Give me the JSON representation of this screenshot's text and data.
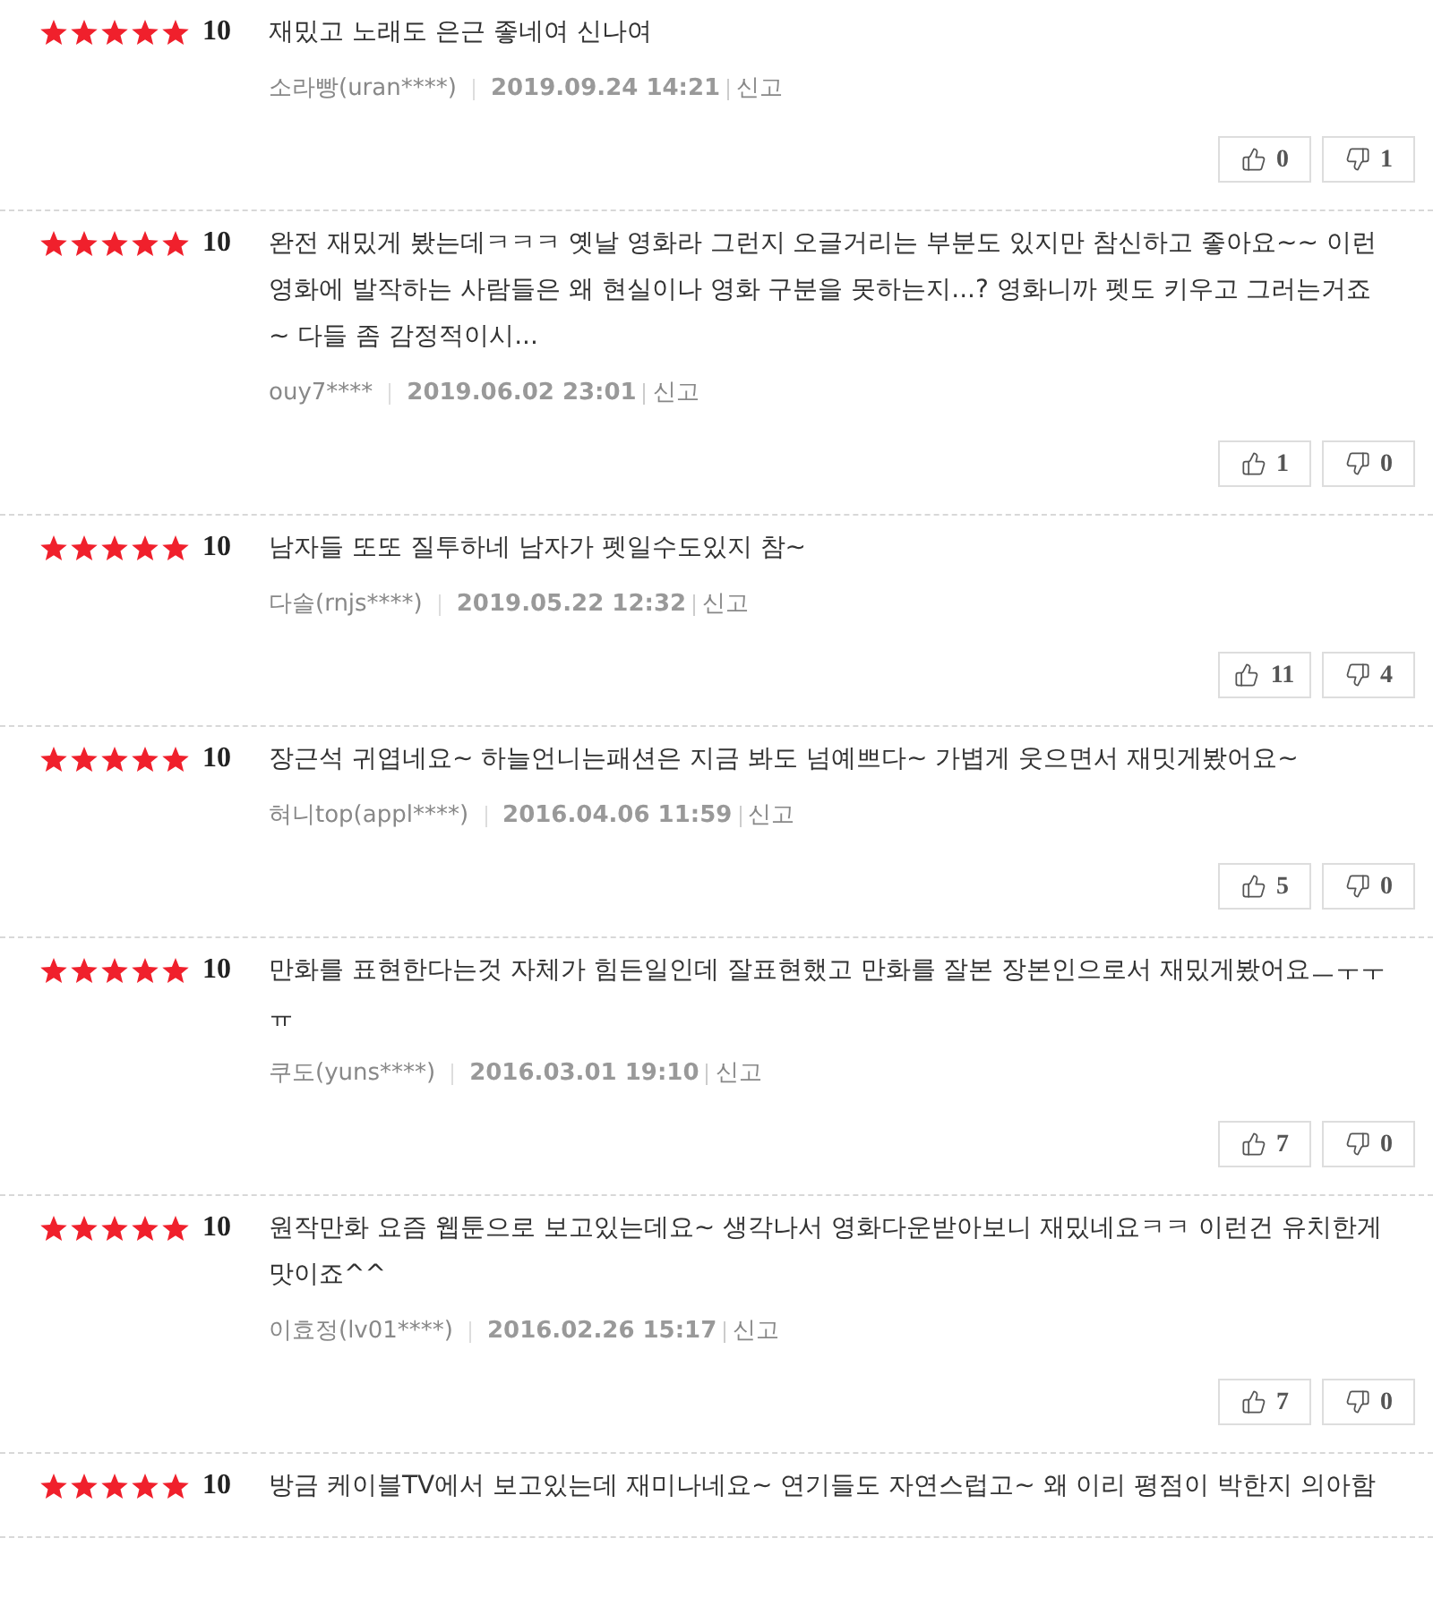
{
  "reviews": [
    {
      "stars": 5,
      "score": "10",
      "text": "재밌고 노래도 은근 좋네여 신나여",
      "author": "소라빵(uran****)",
      "date": "2019.09.24 14:21",
      "report": "신고",
      "likes": "0",
      "dislikes": "1"
    },
    {
      "stars": 5,
      "score": "10",
      "text": "완전 재밌게 봤는데ㅋㅋㅋ 옛날 영화라 그런지 오글거리는 부분도 있지만 참신하고 좋아요~~ 이런 영화에 발작하는 사람들은 왜 현실이나 영화 구분을 못하는지...? 영화니까 펫도 키우고 그러는거죠~ 다들 좀 감정적이시...",
      "author": "ouy7****",
      "date": "2019.06.02 23:01",
      "report": "신고",
      "likes": "1",
      "dislikes": "0"
    },
    {
      "stars": 5,
      "score": "10",
      "text": "남자들 또또 질투하네 남자가 펫일수도있지 참~",
      "author": "다솔(rnjs****)",
      "date": "2019.05.22 12:32",
      "report": "신고",
      "likes": "11",
      "dislikes": "4"
    },
    {
      "stars": 5,
      "score": "10",
      "text": "장근석 귀엽네요~ 하늘언니는패션은 지금 봐도 넘예쁘다~ 가볍게 웃으면서 재밋게봤어요~",
      "author": "혀니top(appl****)",
      "date": "2016.04.06 11:59",
      "report": "신고",
      "likes": "5",
      "dislikes": "0"
    },
    {
      "stars": 5,
      "score": "10",
      "text": "만화를 표현한다는것 자체가 힘든일인데 잘표현했고 만화를 잘본 장본인으로서 재밌게봤어요ㅡㅜㅜㅠ",
      "author": "쿠도(yuns****)",
      "date": "2016.03.01 19:10",
      "report": "신고",
      "likes": "7",
      "dislikes": "0"
    },
    {
      "stars": 5,
      "score": "10",
      "text": "원작만화 요즘 웹툰으로 보고있는데요~ 생각나서 영화다운받아보니 재밌네요ㅋㅋ 이런건 유치한게 맛이죠^^",
      "author": "이효정(lv01****)",
      "date": "2016.02.26 15:17",
      "report": "신고",
      "likes": "7",
      "dislikes": "0"
    },
    {
      "stars": 5,
      "score": "10",
      "text": "방금 케이블TV에서 보고있는데 재미나네요~ 연기들도 자연스럽고~ 왜 이리 평점이 박한지 의아함"
    }
  ]
}
